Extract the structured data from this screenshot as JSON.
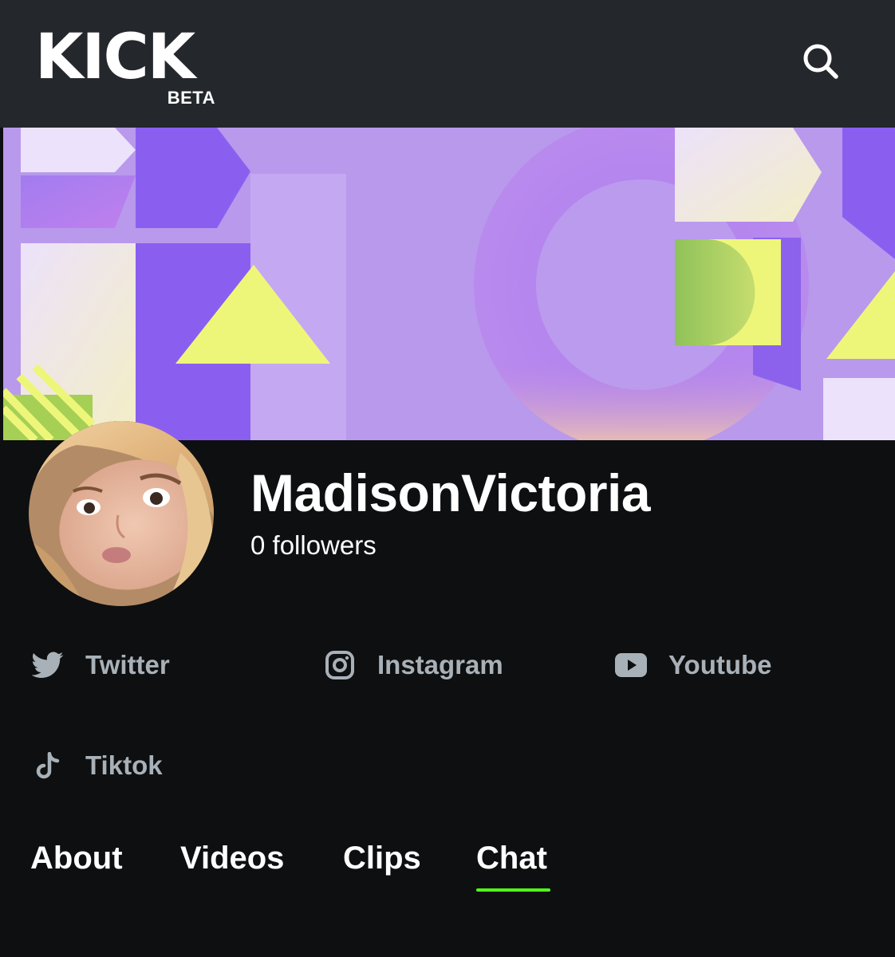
{
  "header": {
    "logo_text": "KICK",
    "logo_badge": "BETA",
    "search_icon": "search-icon"
  },
  "colors": {
    "header_bg": "#24272c",
    "page_bg": "#0e0f10",
    "banner_bg": "#b899ec",
    "accent_green": "#53fc18",
    "muted_text": "#a9b1b8"
  },
  "profile": {
    "username": "MadisonVictoria",
    "followers": "0 followers"
  },
  "socials": [
    {
      "label": "Twitter",
      "icon": "twitter-icon"
    },
    {
      "label": "Instagram",
      "icon": "instagram-icon"
    },
    {
      "label": "Youtube",
      "icon": "youtube-icon"
    },
    {
      "label": "Tiktok",
      "icon": "tiktok-icon"
    }
  ],
  "tabs": [
    {
      "label": "About"
    },
    {
      "label": "Videos"
    },
    {
      "label": "Clips"
    },
    {
      "label": "Chat",
      "active": true
    }
  ]
}
